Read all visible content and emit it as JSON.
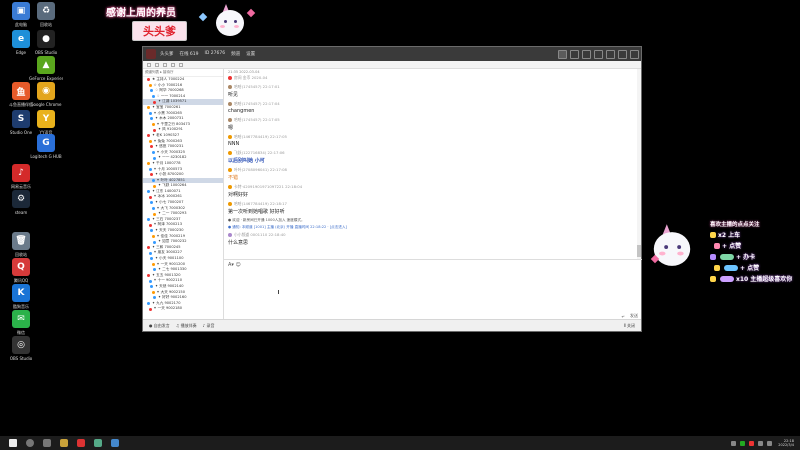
{
  "desktop": {
    "icons": [
      {
        "label": "此电脑",
        "color": "#3a7bd5",
        "glyph": "▣"
      },
      {
        "label": "回收站",
        "color": "#5a6b7d",
        "glyph": "♻"
      },
      {
        "label": "Edge",
        "color": "#1e8fd8",
        "glyph": "e"
      },
      {
        "label": "OBS Studio",
        "color": "#222222",
        "glyph": "●"
      },
      {
        "label": "GeForce Experience",
        "color": "#5aa61d",
        "glyph": "▲"
      },
      {
        "label": "Google Chrome",
        "color": "#e3a51c",
        "glyph": "◉"
      },
      {
        "label": "斗鱼直播伴侣",
        "color": "#e65a2a",
        "glyph": "鱼"
      },
      {
        "label": "Studio One",
        "color": "#1e3c6e",
        "glyph": "S"
      },
      {
        "label": "YY语音",
        "color": "#e9b21c",
        "glyph": "Y"
      },
      {
        "label": "Logitech G HUB",
        "color": "#2a6fd8",
        "glyph": "G"
      },
      {
        "label": "网易云音乐",
        "color": "#d42a2a",
        "glyph": "♪"
      },
      {
        "label": "steam",
        "color": "#1b2838",
        "glyph": "⚙"
      },
      {
        "label": "回收站",
        "color": "#6a7a8a",
        "glyph": "🗑"
      },
      {
        "label": "腾讯QQ",
        "color": "#d63a3a",
        "glyph": "Q"
      },
      {
        "label": "酷狗音乐",
        "color": "#1a74d6",
        "glyph": "K"
      },
      {
        "label": "微信",
        "color": "#2bb24a",
        "glyph": "✉"
      },
      {
        "label": "OBS Studio",
        "color": "#333333",
        "glyph": "◎"
      }
    ]
  },
  "overlay": {
    "banner_top": "感谢上周的养员",
    "banner_name": "头头爹",
    "right_title": "喜欢主播的点点关注",
    "right_rows": [
      {
        "text": "x2 上车",
        "chip": "#8cc0ff",
        "gift": "#ffd54a"
      },
      {
        "text": "+ 点赞",
        "chip": "#b0e0ff",
        "gift": "#ff88b0"
      },
      {
        "text": "+ 办卡",
        "chip": "#7ed6a5",
        "gift": "#b58cff"
      },
      {
        "text": "+ 点赞",
        "chip": "#6cc4ff",
        "gift": "#ffd54a"
      },
      {
        "text": "x10 主播超级喜欢你",
        "chip": "#cba0ff",
        "gift": "#ffd54a"
      }
    ]
  },
  "window": {
    "titlebar": {
      "items": [
        "头头爹",
        "在线 619",
        "ID 27676",
        "频道",
        "设置"
      ]
    },
    "sidebar": {
      "header": "频道列表 ▸ 接待厅",
      "rows": [
        {
          "name": "★ 主持人 7000224",
          "color": "#e33"
        },
        {
          "name": "☆ 小小 7000216",
          "color": "#f90"
        },
        {
          "name": "♢ 阿华 7000268",
          "color": "#39f"
        },
        {
          "name": "♢ 一一 7000214",
          "color": "#39f"
        },
        {
          "name": "✦ 江湖 1039571",
          "color": "#e33",
          "hl": true
        },
        {
          "name": "✦ 宝宝 7000261",
          "color": "#f90"
        },
        {
          "name": "✦ 小黑 7000265",
          "color": "#39f"
        },
        {
          "name": "✦ 木木 2000731",
          "color": "#39f"
        },
        {
          "name": "✦ 千里之行 803473",
          "color": "#f90"
        },
        {
          "name": "✦ 风 9100291",
          "color": "#e33"
        },
        {
          "name": "✦ 老K 1090327",
          "color": "#e33"
        },
        {
          "name": "✦ 兔兔 7000263",
          "color": "#f90"
        },
        {
          "name": "✦ 悠悠 7000231",
          "color": "#e33"
        },
        {
          "name": "✦ 小天 7000325",
          "color": "#39f"
        },
        {
          "name": "✦ 一一 4230182",
          "color": "#39f"
        },
        {
          "name": "✦ 千月 1000778",
          "color": "#f90"
        },
        {
          "name": "✦ 十月 1000573",
          "color": "#39f"
        },
        {
          "name": "✦ 小张 8700200",
          "color": "#e33"
        },
        {
          "name": "✦ 叶叶 4027851",
          "color": "#39f",
          "hl": true
        },
        {
          "name": "✦ 飞跃 1000264",
          "color": "#f90"
        },
        {
          "name": "✦ 江东 1400071",
          "color": "#39f"
        },
        {
          "name": "✦ 冰冰 1000261",
          "color": "#e33"
        },
        {
          "name": "✦ 小七 7000207",
          "color": "#39f"
        },
        {
          "name": "✦ 大飞 7000302",
          "color": "#39f"
        },
        {
          "name": "✦ 二一 7000293",
          "color": "#f90"
        },
        {
          "name": "✦ 三石 7000237",
          "color": "#39f"
        },
        {
          "name": "✦ 阿泽 7000213",
          "color": "#e33"
        },
        {
          "name": "✦ 天天 7000230",
          "color": "#39f"
        },
        {
          "name": "✦ 佳佳 7000219",
          "color": "#f90"
        },
        {
          "name": "✦ 如意 7000232",
          "color": "#39f"
        },
        {
          "name": "✦ 三和 7000245",
          "color": "#e33"
        },
        {
          "name": "✦ 朋友 3000227",
          "color": "#39f"
        },
        {
          "name": "✦ 小天 9001100",
          "color": "#39f"
        },
        {
          "name": "✦ 一天 9001200",
          "color": "#f90"
        },
        {
          "name": "✦ 二七 9001330",
          "color": "#39f"
        },
        {
          "name": "✦ 五五 9001320",
          "color": "#e33"
        },
        {
          "name": "✦ 十一 9002110",
          "color": "#39f"
        },
        {
          "name": "✦ 天然 9002140",
          "color": "#39f"
        },
        {
          "name": "✦ 大天 9002150",
          "color": "#f90"
        },
        {
          "name": "✦ 好好 9002160",
          "color": "#39f"
        },
        {
          "name": "✦ 九九 9002170",
          "color": "#39f"
        },
        {
          "name": "✦ 一天 9002180",
          "color": "#e33"
        }
      ]
    },
    "chat": {
      "top": "21:35 2022-03-04",
      "messages": [
        {
          "meta": "房间 金币 2020-04",
          "text": "",
          "color": "#e33",
          "style": ""
        },
        {
          "meta": "哈哈(1745457) 22:17:01",
          "text": "听见",
          "color": "#a86",
          "style": ""
        },
        {
          "meta": "哈哈(1745457) 22:17:04",
          "text": "changmen",
          "color": "#a86",
          "style": ""
        },
        {
          "meta": "哈哈(1745457) 22:17:05",
          "text": "嗯",
          "color": "#a86",
          "style": ""
        },
        {
          "meta": "哈哈(1467784419) 22:17:05",
          "text": "NNN",
          "color": "#e90",
          "style": ""
        },
        {
          "meta": "飞跃(122716834) 22:17:06",
          "text": "以后别叫她 小可",
          "color": "#e90",
          "style": "blue"
        },
        {
          "meta": "叶叶(2708096041) 22:17:08",
          "text": "不错",
          "color": "#e90",
          "style": "orange"
        },
        {
          "meta": "卡特·42091901971097221 22:18:04",
          "text": "对啊好好",
          "color": "#e90",
          "style": ""
        },
        {
          "meta": "哈哈(1467784419) 22:18:17",
          "text": "第一次听到她唱歌 好好听",
          "color": "#e90",
          "style": ""
        }
      ],
      "sys1": "● 欢迎 · 新房间已开通 1000人加入 速度模式。",
      "sys2": "● 通知: 本频道 [1001] 主播 (北京) 开播 直播时间 22:18:22 · [点击进入]",
      "last_meta": "小小频道 0001110 22:18:40",
      "last_text": "什么意思"
    },
    "editor": {
      "format": "A▾ ☺",
      "send_label": "发送",
      "enter_label": "↵"
    },
    "statusbar": {
      "items": [
        "● 自由发言",
        "♫ 播放伴奏",
        "♪ 录音"
      ],
      "right": "Ⅱ 关闭"
    }
  },
  "taskbar": {
    "time": "22:18",
    "date": "2022/3/4"
  }
}
